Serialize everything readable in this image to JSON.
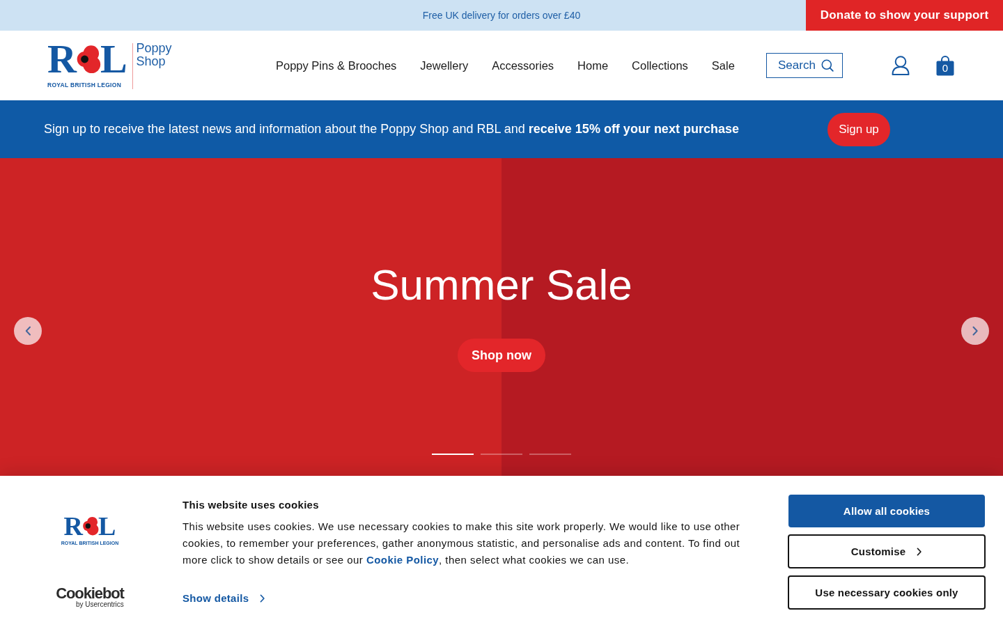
{
  "top_bar": {
    "message": "Free UK delivery for orders over £40",
    "donate_button": "Donate to show your support"
  },
  "header": {
    "logo": {
      "letters": [
        "R",
        "L"
      ],
      "tagline": "ROYAL BRITISH LEGION"
    },
    "shop_name": "Poppy Shop",
    "nav": [
      "Poppy Pins & Brooches",
      "Jewellery",
      "Accessories",
      "Home",
      "Collections",
      "Sale"
    ],
    "search": {
      "label": "Search"
    },
    "cart_count": "0"
  },
  "signup_banner": {
    "text": "Sign up to receive the latest news and information about the Poppy Shop and RBL and **receive 15% off your next purchase**",
    "button": "Sign up"
  },
  "hero": {
    "title": "Summer Sale",
    "button": "Shop now",
    "slides": [
      {
        "selected": true
      },
      {
        "selected": false
      },
      {
        "selected": false
      }
    ]
  },
  "cookie_banner": {
    "logo": {
      "letters": [
        "R",
        "L"
      ],
      "tagline": "ROYAL BRITISH LEGION"
    },
    "provider_logo": {
      "name": "Cookiebot",
      "byline": "by Usercentrics"
    },
    "title": "This website uses cookies",
    "body": [
      {
        "kind": "text",
        "text": "This website uses cookies. We use necessary cookies to make this site work properly. We would like to use other cookies, to remember your preferences, gather anonymous statistic, and personalise ads and content. To find out more click to show details or see our "
      },
      {
        "kind": "link",
        "text": "Cookie Policy"
      },
      {
        "kind": "text",
        "text": ", then select what cookies we can use."
      }
    ],
    "show_details": "Show details",
    "buttons": [
      {
        "kind": "primary",
        "label": "Allow all cookies"
      },
      {
        "kind": "expand",
        "label": "Customise"
      },
      {
        "kind": "outline",
        "label": "Use necessary cookies only"
      }
    ]
  }
}
